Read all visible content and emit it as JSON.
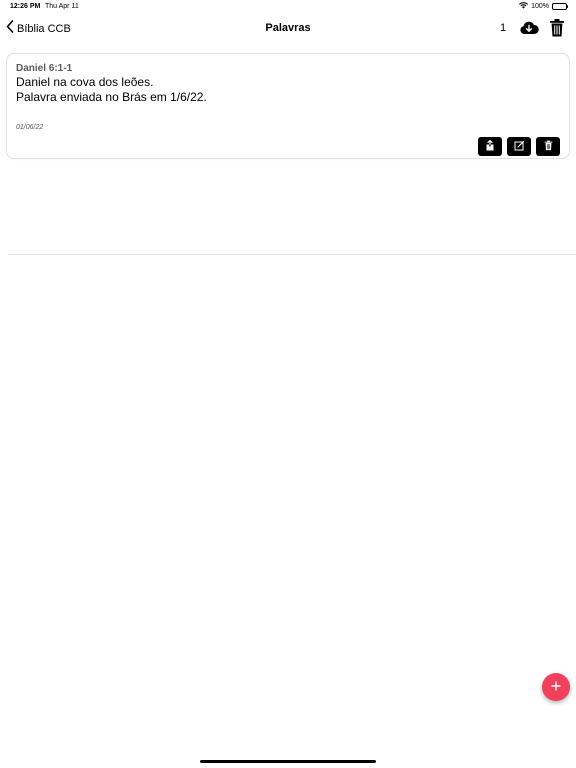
{
  "status_bar": {
    "time": "12:26 PM",
    "date": "Thu Apr 11",
    "battery": "100%",
    "wifi_icon": "wifi-icon",
    "battery_icon": "battery-icon"
  },
  "nav": {
    "back_label": "Bíblia CCB",
    "title": "Palavras",
    "count": "1",
    "cloud_icon": "cloud-download-icon",
    "trash_icon": "trash-icon"
  },
  "cards": [
    {
      "reference": "Daniel 6:1-1",
      "text": "Daniel na cova dos leões.\nPalavra enviada no Brás em 1/6/22.",
      "date": "01/06/22",
      "actions": [
        "share-icon",
        "edit-icon",
        "trash-icon"
      ]
    }
  ],
  "fab": {
    "icon": "plus-icon",
    "color": "#f23f5c"
  }
}
